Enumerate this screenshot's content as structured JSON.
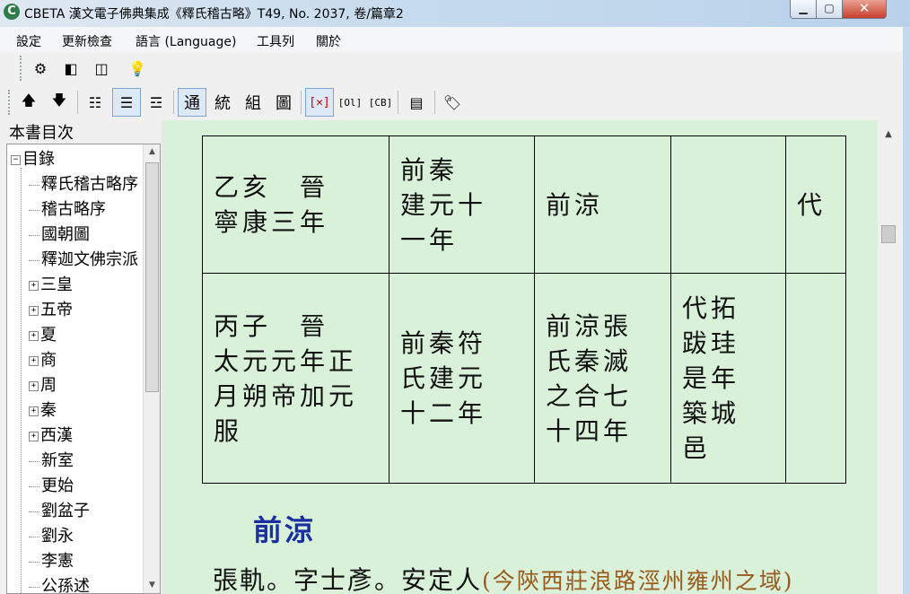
{
  "window": {
    "title": "CBETA 漢文電子佛典集成《釋氏稽古略》T49, No. 2037, 卷/篇章2",
    "app_icon": "C",
    "minimize": "▁",
    "maximize": "▢",
    "close": "✕"
  },
  "menu": [
    "設定",
    "更新檢查",
    "語言 (Language)",
    "工具列",
    "關於"
  ],
  "toolbar1": {
    "icons": [
      "gear-icon",
      "single-pane-icon",
      "dual-pane-icon",
      "lightbulb-icon"
    ],
    "glyphs": [
      "⚙",
      "◧",
      "◫",
      "💡"
    ]
  },
  "toolbar2": {
    "up": "🡅",
    "down": "🡇",
    "layout_glyphs": [
      "☷",
      "☰",
      "☲"
    ],
    "mode_chars": [
      "通",
      "統",
      "組",
      "圖"
    ],
    "close_box": "[✕]",
    "ol_label": "[Ol]",
    "cb_label": "[CB]",
    "page_glyph": "▤",
    "tag_glyph": "🏷"
  },
  "toc": {
    "title": "本書目次",
    "items": [
      {
        "label": "目錄",
        "level": 0,
        "expander": "−"
      },
      {
        "label": "釋氏稽古略序",
        "level": 1,
        "expander": ""
      },
      {
        "label": "稽古略序",
        "level": 1,
        "expander": ""
      },
      {
        "label": "國朝圖",
        "level": 1,
        "expander": ""
      },
      {
        "label": "釋迦文佛宗派",
        "level": 1,
        "expander": ""
      },
      {
        "label": "三皇",
        "level": 1,
        "expander": "+"
      },
      {
        "label": "五帝",
        "level": 1,
        "expander": "+"
      },
      {
        "label": "夏",
        "level": 1,
        "expander": "+"
      },
      {
        "label": "商",
        "level": 1,
        "expander": "+"
      },
      {
        "label": "周",
        "level": 1,
        "expander": "+"
      },
      {
        "label": "秦",
        "level": 1,
        "expander": "+"
      },
      {
        "label": "西漢",
        "level": 1,
        "expander": "+"
      },
      {
        "label": "新室",
        "level": 1,
        "expander": ""
      },
      {
        "label": "更始",
        "level": 1,
        "expander": ""
      },
      {
        "label": "劉盆子",
        "level": 1,
        "expander": ""
      },
      {
        "label": "劉永",
        "level": 1,
        "expander": ""
      },
      {
        "label": "李憲",
        "level": 1,
        "expander": ""
      },
      {
        "label": "公孫述",
        "level": 1,
        "expander": ""
      }
    ]
  },
  "table": {
    "rows": [
      [
        "乙亥　晉\n寧康三年",
        "前秦\n建元十\n一年",
        "前涼",
        "",
        "代"
      ],
      [
        "丙子　晉\n太元元年正\n月朔帝加元\n服",
        "前秦符\n氏建元\n十二年",
        "前涼張\n氏秦滅\n之合七\n十四年",
        "代拓\n跋珪\n是年\n築城\n邑",
        ""
      ]
    ]
  },
  "section_heading": "前涼",
  "body": {
    "text": "張軌。字士彥。安定人",
    "note": "(今陝西莊浪路涇州雍州之域)"
  },
  "scrollbar": {
    "up": "▲",
    "down": "▼"
  }
}
